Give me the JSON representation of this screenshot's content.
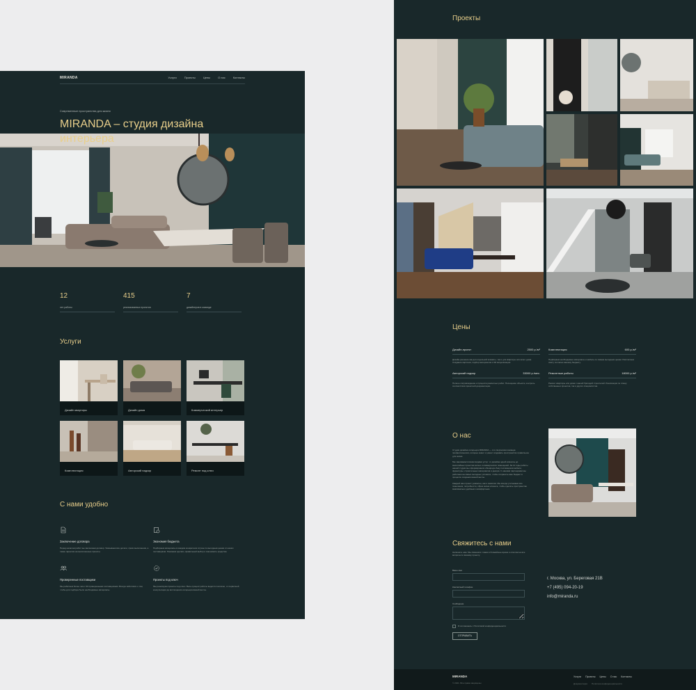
{
  "brand": "MIRANDA",
  "nav": [
    "Услуги",
    "Проекты",
    "Цены",
    "О нас",
    "Контакты"
  ],
  "hero": {
    "subtitle": "Современные пространства для жизни",
    "title": "MIRANDA – студия дизайна интерьера"
  },
  "stats": [
    {
      "value": "12",
      "label": "лет работы"
    },
    {
      "value": "415",
      "label": "реализованных проектов"
    },
    {
      "value": "7",
      "label": "дизайнеров в команде"
    }
  ],
  "services": {
    "title": "Услуги",
    "items": [
      "Дизайн квартиры",
      "Дизайн дома",
      "Коммерческий интерьер",
      "Комплектация",
      "Авторский надзор",
      "Ремонт под ключ"
    ]
  },
  "advantages": {
    "title": "С нами удобно",
    "items": [
      {
        "title": "Заключение договора",
        "text": "Перед началом работ мы заключаем договор. Указываем все детали, сроки выполнения, а также гарантии на выполненные проекты."
      },
      {
        "title": "Экономия бюджета",
        "text": "Подбираем материалы в каждом конкретном случае по выгодным ценам от наших поставщиков. Поможем сделать правильный выбор и сэкономить средства."
      },
      {
        "title": "Проверенные поставщики",
        "text": "Мы работаем более чем с 30 проверенными поставщиками. Всегда заботимся о том, чтобы для подбора были необходимые материалы."
      },
      {
        "title": "Проекты под ключ",
        "text": "Мы реализуем проекты под ключ. Весь процесс работы ведется поэтапно, от первичной консультации до воплощения интерьера вашей мечты."
      }
    ]
  },
  "projects": {
    "title": "Проекты"
  },
  "prices": {
    "title": "Цены",
    "items": [
      {
        "name": "Дизайн-проект",
        "price": "2500 р./м²",
        "desc": "Дизайн-решение как для отдельной комнаты, так и для квартиры или всего дома. Создание картинок, подбор материалов и 3D визуализация."
      },
      {
        "name": "Комплектация",
        "price": "600 р./м²",
        "desc": "Подбираем необходимые материалы и мебель по самым выгодным ценам. Рассчитаем смету согласно вашему бюджету."
      },
      {
        "name": "Авторский надзор",
        "price": "33000 р./мес.",
        "desc": "Полное сопровождение и процесса ремонтных работ. Посещение объекта, контроль соответствия проектной документации."
      },
      {
        "name": "Ремонтные работы",
        "price": "18000 р./м²",
        "desc": "Ремонт квартиры или дома с нашей бригадой строителей. Реализация по плану: собственных проектов, так и других специалистов."
      }
    ]
  },
  "about": {
    "title": "О нас",
    "paragraphs": [
      "Студия дизайна интерьера MIRANDA — это творческая команда профессионалов, которые знают и умеют создавать пространство правильное для жизни.",
      "Мы занимаемся всеми видами услуг: от дизайна одной комнаты до масштабных проектов жилых и коммерческих помещений. За 12 годы работы нашей студии мы сформировали обширную базу поставщиков мебели, фурнитуры, строительных материалов и декора. С нашими партнерами мы работаем на самых выгодных условиях, чтобы сохранить ваш бюджет в процессе создания вашей мечты.",
      "Каждый наш проект уникален, как и заказчик. Мы всегда учитываем все пожелания, потребности, образ жизни клиента, чтобы сделать пространство максимально удобным и комфортным."
    ]
  },
  "contact": {
    "title": "Свяжитесь с нами",
    "intro": "Напишите нам. Мы свяжемся с вами в ближайшее время и ответим на все вопросы по вашему проекту.",
    "name_label": "Ваше имя",
    "phone_label": "Контактный телефон",
    "message_label": "Сообщение",
    "consent": "Я соглашаюсь с Политикой конфиденциальности",
    "submit": "ОТПРАВИТЬ",
    "address": "г. Москва, ул. Береговая 21В",
    "phone": "+7 (495) 094-20-19",
    "email": "info@miranda.ru"
  },
  "footer": {
    "copyright": "© 2021. Все права защищены",
    "legal": [
      "Документация",
      "Политика конфиденциальности"
    ]
  },
  "colors": {
    "bg": "#19282a",
    "accent": "#e9cf8b",
    "page": "#ededee"
  }
}
